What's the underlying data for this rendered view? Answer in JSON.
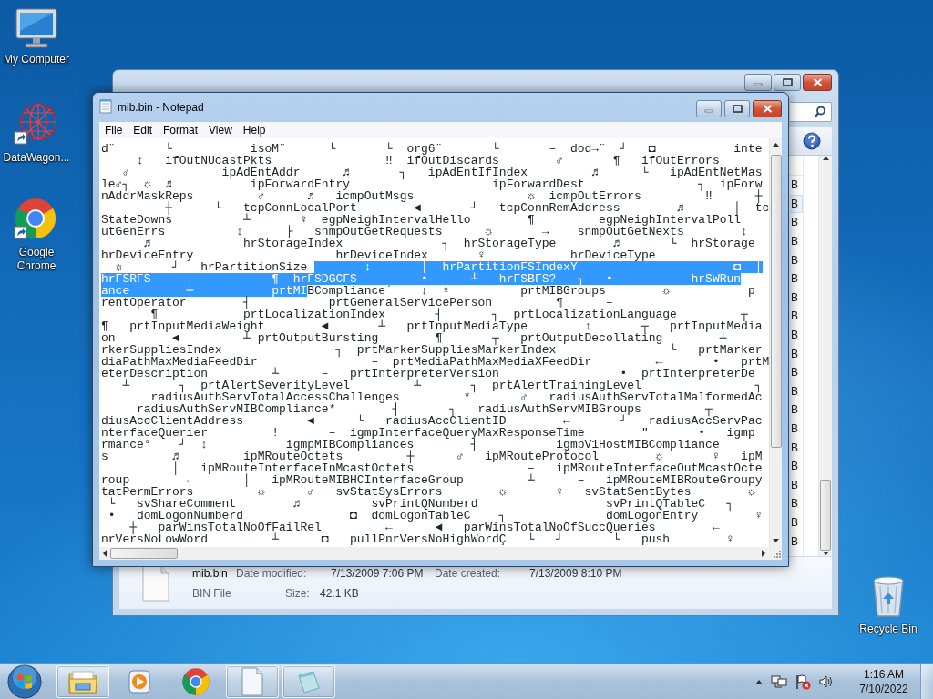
{
  "desktop_icons": [
    {
      "label": "My Computer",
      "kind": "computer"
    },
    {
      "label": "DataWagon...",
      "kind": "globe"
    },
    {
      "label": "Google Chrome",
      "kind": "chrome"
    },
    {
      "label": "Recycle Bin",
      "kind": "recycle"
    }
  ],
  "explorer": {
    "size_column": [
      {
        "text": "B",
        "selected": false
      },
      {
        "text": "B",
        "selected": true
      },
      {
        "text": "B",
        "selected": false
      },
      {
        "text": "B",
        "selected": false
      },
      {
        "text": "B",
        "selected": false
      },
      {
        "text": "B",
        "selected": false
      },
      {
        "text": "B",
        "selected": false
      },
      {
        "text": "B",
        "selected": false
      },
      {
        "text": "B",
        "selected": false
      },
      {
        "text": "B",
        "selected": false
      },
      {
        "text": "B",
        "selected": false
      },
      {
        "text": "B",
        "selected": false
      },
      {
        "text": "B",
        "selected": false
      },
      {
        "text": "B",
        "selected": false
      },
      {
        "text": "B",
        "selected": false
      },
      {
        "text": "B",
        "selected": false
      },
      {
        "text": "B",
        "selected": false
      },
      {
        "text": "B",
        "selected": false
      },
      {
        "text": "B",
        "selected": false
      },
      {
        "text": "B",
        "selected": false
      }
    ],
    "details": {
      "name": "mib.bin",
      "type": "BIN File",
      "fields": [
        {
          "label": "Date modified:",
          "value": "7/13/2009 7:06 PM"
        },
        {
          "label": "Date created:",
          "value": "7/13/2009 8:10 PM"
        },
        {
          "label": "Size:",
          "value": "42.1 KB"
        }
      ]
    }
  },
  "notepad": {
    "title": "mib.bin - Notepad",
    "menu": [
      "File",
      "Edit",
      "Format",
      "View",
      "Help"
    ],
    "lines": [
      {
        "segments": [
          {
            "text": "d¨       └           isoM¨      └       └  org6¨       └       –  dod→¨  ┘   ◘           inte",
            "selected": false
          }
        ]
      },
      {
        "segments": [
          {
            "text": "     ↕   ifOutNUcastPkts                ‼  ifOutDiscards        ♂       ¶   ifOutErrors",
            "selected": false
          }
        ]
      },
      {
        "segments": [
          {
            "text": "   ♂             ipAdEntAddr      ♬       ┐   ipAdEntIfIndex         ♬      └   ipAdEntNetMas",
            "selected": false
          }
        ]
      },
      {
        "segments": [
          {
            "text": "le♂┐  ☼  ♬           ipForwardEntry                    ipForwardDest                ┐  ipForw",
            "selected": false
          }
        ]
      },
      {
        "segments": [
          {
            "text": "nAddrMaskReps         ♂      ♬   icmpOutMsgs                ☼  icmpOutErrors         ‼      ┼",
            "selected": false
          }
        ]
      },
      {
        "segments": [
          {
            "text": "         ┼      └   tcpConnLocalPort        ◄       ┘   tcpConnRemAddress        ♬       │  tc",
            "selected": false
          }
        ]
      },
      {
        "segments": [
          {
            "text": "StateDowns          ┴       ♀  egpNeighIntervalHello        ¶         egpNeighIntervalPoll",
            "selected": false
          }
        ]
      },
      {
        "segments": [
          {
            "text": "utGenErrs          ↕      ├   snmpOutGetRequests      ☼       →    snmpOutGetNexts        ↕",
            "selected": false
          }
        ]
      },
      {
        "segments": [
          {
            "text": "      ♬             hrStorageIndex              ┐  hrStorageType        ♬       └  hrStorage",
            "selected": false
          }
        ]
      },
      {
        "segments": [
          {
            "text": "hrDeviceEntry                    hrDeviceIndex       ♀            hrDeviceType",
            "selected": false
          }
        ]
      },
      {
        "segments": [
          {
            "text": "  ☼       ┘   hrPartitionSize ",
            "selected": false
          },
          {
            "text": "       ↕       │  hrPartitionFSIndexY                      ◘  │",
            "selected": true
          }
        ]
      },
      {
        "segments": [
          {
            "text": "hrFSRFS                 ¶  hrFSDGCFS         •      ┴   hrFSBFS?   ┐   •           hrSWRun",
            "selected": true
          }
        ]
      },
      {
        "segments": [
          {
            "text": "ance        ┼           prtMI",
            "selected": true
          },
          {
            "text": "BCompliance´    ↕  ♀          prtMIBGroups        ☼           p",
            "selected": false
          }
        ]
      },
      {
        "segments": [
          {
            "text": "rentOperator        ┤           prtGeneralServicePerson         ¶      –",
            "selected": false
          }
        ]
      },
      {
        "segments": [
          {
            "text": "       ¶            prtLocalizationIndex       ┤       ┐  prtLocalizationLanguage         ┬",
            "selected": false
          }
        ]
      },
      {
        "segments": [
          {
            "text": "¶   prtInputMediaWeight        ◄       ┴   prtInputMediaType        ↕       ┬   prtInputMedia",
            "selected": false
          }
        ]
      },
      {
        "segments": [
          {
            "text": "on        ◄         ┴ prtOutputBursting        ¶       ┬   prtOutputDecollating        ┴",
            "selected": false
          }
        ]
      },
      {
        "segments": [
          {
            "text": "rkerSuppliesIndex                ┐  prtMarkerSuppliesMarkerIndex                └   prtMarker",
            "selected": false
          }
        ]
      },
      {
        "segments": [
          {
            "text": "diaPathMaxMediaFeedDir                –  prtMediaPathMaxMediaXFeedDir         ←       •   prtM",
            "selected": false
          }
        ]
      },
      {
        "segments": [
          {
            "text": "eterDescription         ┴      –   prtInterpreterVersion                 •  prtInterpreterDe",
            "selected": false
          }
        ]
      },
      {
        "segments": [
          {
            "text": "   ┴       ┐  prtAlertSeverityLevel         ┴       ┐  prtAlertTrainingLevel                ┐",
            "selected": false
          }
        ]
      },
      {
        "segments": [
          {
            "text": "       radiusAuthServTotalAccessChallenges         *       ♂   radiusAuthServTotalMalformedAc",
            "selected": false
          }
        ]
      },
      {
        "segments": [
          {
            "text": "     radiusAuthServMIBCompliance*        ┤       ┐   radiusAuthServMIBGroups         ┬",
            "selected": false
          }
        ]
      },
      {
        "segments": [
          {
            "text": "diusAccClientAddress         ◄      └   radiusAccClientID        ←       ┘   radiusAccServPac",
            "selected": false
          }
        ]
      },
      {
        "segments": [
          {
            "text": "nterfaceQuerier         !       –  igmpInterfaceQueryMaxResponseTime        \"       •   igmp",
            "selected": false
          }
        ]
      },
      {
        "segments": [
          {
            "text": "rmance°    ┘  ↕           igmpMIBCompliances        ┤           igmpV1HostMIBCompliance",
            "selected": false
          }
        ]
      },
      {
        "segments": [
          {
            "text": "s         ♬         ipMRouteOctets         ┼      ♂   ipMRouteProtocol        ☼       ♀   ipM",
            "selected": false
          }
        ]
      },
      {
        "segments": [
          {
            "text": "          │   ipMRouteInterfaceInMcastOctets                –   ipMRouteInterfaceOutMcastOcte",
            "selected": false
          }
        ]
      },
      {
        "segments": [
          {
            "text": "roup        ←       │   ipMRouteMIBHCInterfaceGroup         ┴      –   ipMRouteMIBRouteGroupy",
            "selected": false
          }
        ]
      },
      {
        "segments": [
          {
            "text": "tatPermErrors         ☼      ♂   svStatSysErrors        ☼       ♀   svStatSentBytes        ☼",
            "selected": false
          }
        ]
      },
      {
        "segments": [
          {
            "text": " └   svShareComment        ♬          svPrintQNumberd                  svPrintQTableC   ┐",
            "selected": false
          }
        ]
      },
      {
        "segments": [
          {
            "text": " •   domLogonNumberd               ◘  domLogonTableC    ┐              domLogonEntry        ♀",
            "selected": false
          }
        ]
      },
      {
        "segments": [
          {
            "text": "    ┼   parWinsTotalNoOfFailRel         ←      ◄   parWinsTotalNoOfSuccQueries        ←",
            "selected": false
          }
        ]
      },
      {
        "segments": [
          {
            "text": "nrVersNoLowWord         ┴      ◘   pullPnrVersNoHighWordÇ   └   ┘       └   push        ♀",
            "selected": false
          }
        ]
      }
    ]
  },
  "taskbar": {
    "apps": [
      {
        "kind": "explorer",
        "running": true
      },
      {
        "kind": "media",
        "running": false
      },
      {
        "kind": "chrome",
        "running": false
      },
      {
        "kind": "document",
        "running": true
      },
      {
        "kind": "notepad",
        "running": true
      }
    ],
    "clock": {
      "time": "1:16 AM",
      "date": "7/10/2022"
    }
  }
}
